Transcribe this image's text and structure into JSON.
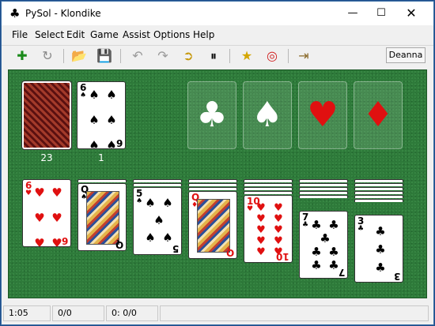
{
  "window": {
    "title": "PySol - Klondike",
    "app_icon": "♣"
  },
  "controls": {
    "minimize": "—",
    "maximize": "☐",
    "close": "✕"
  },
  "menu": [
    "File",
    "Select",
    "Edit",
    "Game",
    "Assist",
    "Options",
    "Help"
  ],
  "toolbar": {
    "icons": [
      "new-game-icon",
      "restart-icon",
      "open-icon",
      "save-icon",
      "undo-icon",
      "redo-icon",
      "autodrop-icon",
      "pause-icon",
      "statistics-icon",
      "rules-icon",
      "quit-icon"
    ],
    "glyphs": {
      "new": "✚",
      "restart": "↻",
      "open": "📂",
      "save": "💾",
      "undo": "↶",
      "redo": "↷",
      "autodrop": "➲",
      "pause": "⏸",
      "stats": "★",
      "rules": "◎",
      "quit": "⇥"
    },
    "player": "Deanna"
  },
  "colors": {
    "felt": "#2e7a3a",
    "red_suit": "#e01010"
  },
  "stock": {
    "count": "23"
  },
  "waste": {
    "count": "1",
    "top": {
      "rank": "6",
      "suit": "♠",
      "color": "black"
    }
  },
  "foundations": [
    {
      "suit": "♣",
      "color": "white"
    },
    {
      "suit": "♠",
      "color": "white"
    },
    {
      "suit": "♥",
      "color": "red"
    },
    {
      "suit": "♦",
      "color": "red"
    }
  ],
  "tableau": [
    {
      "hidden": 0,
      "rank": "6",
      "suit": "♥",
      "color": "red"
    },
    {
      "hidden": 1,
      "rank": "Q",
      "suit": "♠",
      "color": "black"
    },
    {
      "hidden": 2,
      "rank": "5",
      "suit": "♠",
      "color": "black"
    },
    {
      "hidden": 3,
      "rank": "Q",
      "suit": "♦",
      "color": "red"
    },
    {
      "hidden": 4,
      "rank": "10",
      "suit": "♥",
      "color": "red"
    },
    {
      "hidden": 5,
      "rank": "7",
      "suit": "♣",
      "color": "black"
    },
    {
      "hidden": 6,
      "rank": "3",
      "suit": "♣",
      "color": "black"
    }
  ],
  "status": {
    "time": "1:05",
    "moves": "0/0",
    "score": "0: 0/0"
  }
}
